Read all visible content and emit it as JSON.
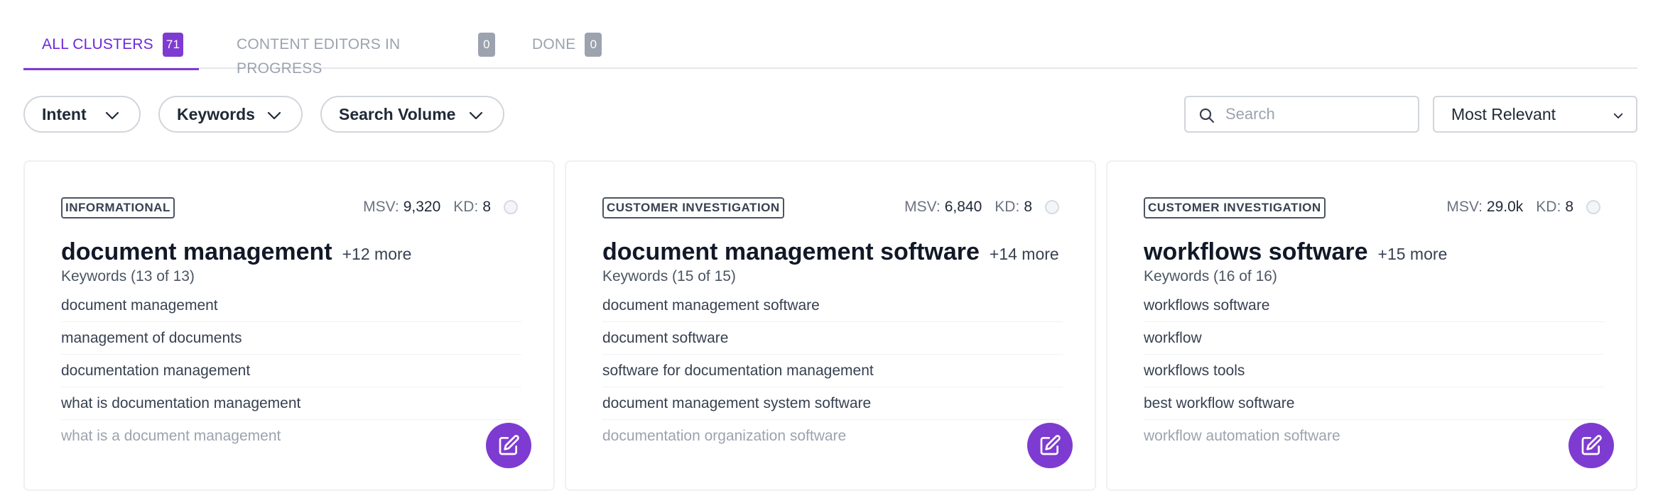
{
  "tabs": [
    {
      "label": "ALL CLUSTERS",
      "count": "71",
      "active": true
    },
    {
      "label": "CONTENT EDITORS IN PROGRESS",
      "count": "0",
      "active": false
    },
    {
      "label": "DONE",
      "count": "0",
      "active": false
    }
  ],
  "filters": {
    "intent": "Intent",
    "keywords": "Keywords",
    "search_volume": "Search Volume"
  },
  "search": {
    "placeholder": "Search",
    "value": ""
  },
  "sort": {
    "selected": "Most Relevant"
  },
  "colors": {
    "accent": "#7e3bd1",
    "inactive_tab": "#9ca3af",
    "border": "#d1d5db"
  },
  "icons": {
    "filter_chevron": "chevron-down-icon",
    "search": "search-icon",
    "edit": "edit-icon"
  },
  "cards": [
    {
      "intent": "INFORMATIONAL",
      "msv_label": "MSV:",
      "msv": "9,320",
      "kd_label": "KD:",
      "kd": "8",
      "title": "document management",
      "more": "+12 more",
      "keywords_count": "Keywords (13 of 13)",
      "keywords": [
        "document management",
        "management of documents",
        "documentation management",
        "what is documentation management",
        "what is a document management"
      ]
    },
    {
      "intent": "CUSTOMER INVESTIGATION",
      "msv_label": "MSV:",
      "msv": "6,840",
      "kd_label": "KD:",
      "kd": "8",
      "title": "document management software",
      "more": "+14 more",
      "keywords_count": "Keywords (15 of 15)",
      "keywords": [
        "document management software",
        "document software",
        "software for documentation management",
        "document management system software",
        "documentation organization software"
      ]
    },
    {
      "intent": "CUSTOMER INVESTIGATION",
      "msv_label": "MSV:",
      "msv": "29.0k",
      "kd_label": "KD:",
      "kd": "8",
      "title": "workflows software",
      "more": "+15 more",
      "keywords_count": "Keywords (16 of 16)",
      "keywords": [
        "workflows software",
        "workflow",
        "workflows tools",
        "best workflow software",
        "workflow automation software"
      ]
    }
  ]
}
